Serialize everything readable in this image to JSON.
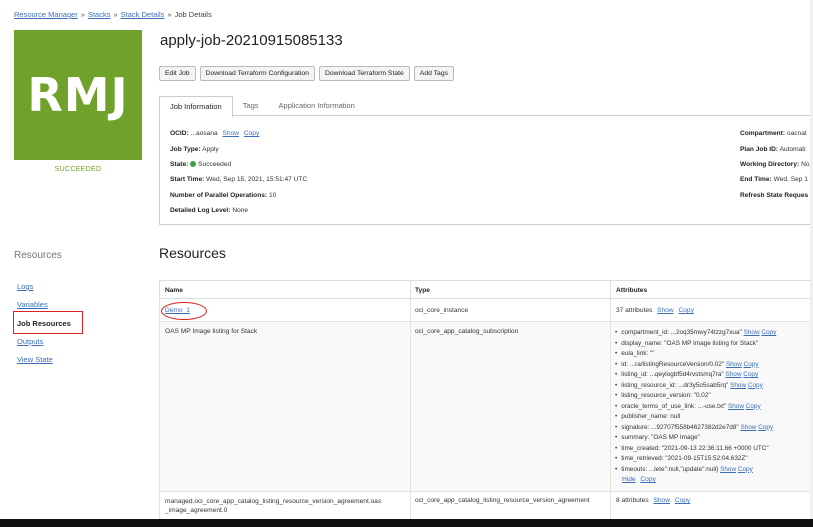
{
  "breadcrumb": [
    "Resource Manager",
    "Stacks",
    "Stack Details",
    "Job Details"
  ],
  "badge": {
    "initials": "RMJ",
    "status": "SUCCEEDED",
    "color": "#6fa12b"
  },
  "header": {
    "title": "apply-job-20210915085133",
    "buttons": [
      "Edit Job",
      "Download Terraform Configuration",
      "Download Terraform State",
      "Add Tags"
    ]
  },
  "tabs": [
    "Job Information",
    "Tags",
    "Application Information"
  ],
  "job_info": {
    "ocid_label": "OCID:",
    "ocid_value": "...aosana",
    "show": "Show",
    "copy": "Copy",
    "job_type_label": "Job Type:",
    "job_type_value": "Apply",
    "state_label": "State:",
    "state_value": "Succeeded",
    "start_label": "Start Time:",
    "start_value": "Wed, Sep 15, 2021, 15:51:47 UTC",
    "parallel_label": "Number of Parallel Operations:",
    "parallel_value": "10",
    "log_label": "Detailed Log Level:",
    "log_value": "None",
    "compartment_label": "Compartment:",
    "compartment_value": "oacnat",
    "plan_label": "Plan Job ID:",
    "plan_value": "Automati",
    "workdir_label": "Working Directory:",
    "workdir_value": "No",
    "end_label": "End Time:",
    "end_value": "Wed, Sep 1",
    "refresh_label": "Refresh State Reques"
  },
  "nav": {
    "title": "Resources",
    "items": [
      "Logs",
      "Variables",
      "Job Resources",
      "Outputs",
      "View State"
    ]
  },
  "resources": {
    "title": "Resources",
    "columns": [
      "Name",
      "Type",
      "Attributes"
    ],
    "rows": [
      {
        "name": "Demo_1",
        "type": "oci_core_instance",
        "attrs": "37 attributes",
        "show": "Show",
        "copy": "Copy"
      },
      {
        "name": "OAS MP Image listing for Stack",
        "type": "oci_core_app_catalog_subscription"
      },
      {
        "name": "managed.oci_core_app_catalog_listing_resource_version_agreement.oas",
        "name2": "_image_agreement.0",
        "type": "oci_core_app_catalog_listing_resource_version_agreement",
        "attrs": "8 attributes",
        "show": "Show",
        "copy": "Copy"
      }
    ],
    "attributes": [
      "compartment_id: ...2oq35mwy74tzzg7xua\"",
      "display_name: \"OAS MP Image listing for Stack\"",
      "eula_link: \"\"",
      "id: ...ra/listingResourceVersion/0.02\"",
      "listing_id: ...qeylogbf5d4rvstsmq7ra\"",
      "listing_resource_id: ...dr3y5o5sab5rq\"",
      "listing_resource_version: \"0.02\"",
      "oracle_terms_of_use_link: ...-use.txt\"",
      "publisher_name: null",
      "signature: ...92707f558b4627382d2e7d8\"",
      "summary: \"OAS MP Image\"",
      "time_created: \"2021-09-13 22:36:11.66 +0000 UTC\"",
      "time_retrieved: \"2021-09-15T15:52:04.632Z\"",
      "timeouts: ...lete\":null,\"update\":null}"
    ],
    "hide": "Hide",
    "copy": "Copy"
  }
}
